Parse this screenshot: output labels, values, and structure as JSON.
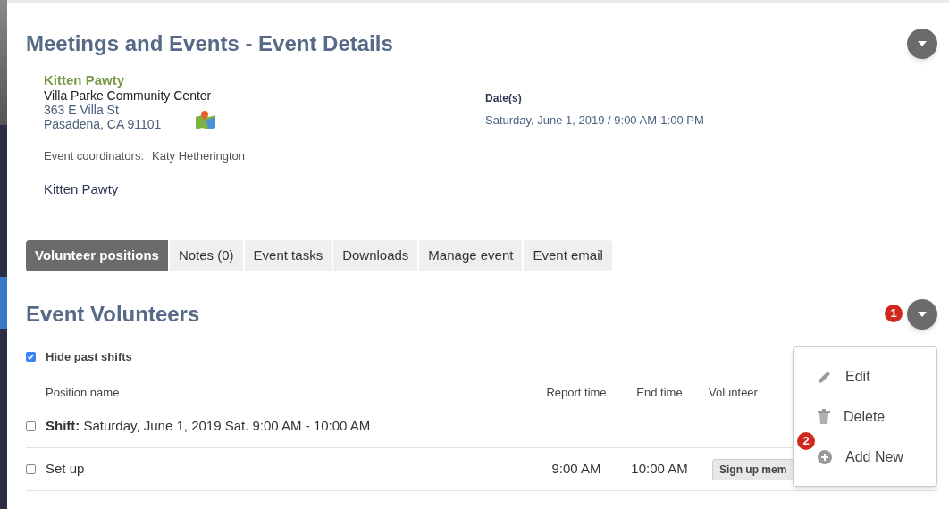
{
  "page_title": "Meetings and Events - Event Details",
  "event": {
    "name": "Kitten Pawty",
    "venue": "Villa Parke Community Center",
    "address_line_1": "363 E Villa St",
    "address_line_2": "Pasadena, CA 91101",
    "coordinators_label": "Event coordinators:",
    "coordinators": "Katy Hetherington",
    "description": "Kitten Pawty",
    "dates_label": "Date(s)",
    "dates": "Saturday, June 1, 2019 / 9:00 AM-1:00 PM"
  },
  "tabs": [
    {
      "label": "Volunteer positions",
      "selected": true
    },
    {
      "label": "Notes (0)",
      "selected": false
    },
    {
      "label": "Event tasks",
      "selected": false
    },
    {
      "label": "Downloads",
      "selected": false
    },
    {
      "label": "Manage event",
      "selected": false
    },
    {
      "label": "Event email",
      "selected": false
    }
  ],
  "section_title": "Event Volunteers",
  "hide_past_shifts": {
    "label": "Hide past shifts",
    "checked": true
  },
  "table": {
    "columns": [
      "Position name",
      "Report time",
      "End time",
      "Volunteer"
    ],
    "rows": [
      {
        "kind": "shift",
        "checked": false,
        "name": "**Shift:** Saturday, June 1, 2019 Sat. 9:00 AM - 10:00 AM"
      },
      {
        "kind": "position",
        "checked": false,
        "name": "Set up",
        "report_time": "9:00 AM",
        "end_time": "10:00 AM",
        "button": "Sign up mem"
      }
    ]
  },
  "badges": [
    "1",
    "2"
  ],
  "menu": {
    "items": [
      {
        "kind": "edit",
        "label": "Edit"
      },
      {
        "kind": "delete",
        "label": "Delete"
      },
      {
        "kind": "add",
        "label": "Add New"
      }
    ]
  }
}
